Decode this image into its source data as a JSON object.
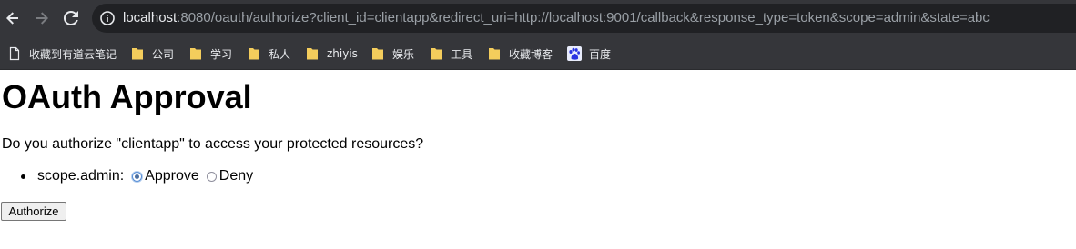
{
  "browser": {
    "url_host": "localhost",
    "url_rest": ":8080/oauth/authorize?client_id=clientapp&redirect_uri=http://localhost:9001/callback&response_type=token&scope=admin&state=abc",
    "bookmarks": [
      {
        "label": "收藏到有道云笔记",
        "icon": "page-icon"
      },
      {
        "label": "公司",
        "icon": "folder-icon"
      },
      {
        "label": "学习",
        "icon": "folder-icon"
      },
      {
        "label": "私人",
        "icon": "folder-icon"
      },
      {
        "label": "zhiyis",
        "icon": "folder-icon"
      },
      {
        "label": "娱乐",
        "icon": "folder-icon"
      },
      {
        "label": "工具",
        "icon": "folder-icon"
      },
      {
        "label": "收藏博客",
        "icon": "folder-icon"
      },
      {
        "label": "百度",
        "icon": "baidu-paw-icon"
      }
    ],
    "colors": {
      "chrome": "#35363a",
      "omnibox": "#202124",
      "folder": "#f4cd5c",
      "baidu": "#2932e1"
    }
  },
  "page": {
    "title": "OAuth Approval",
    "question": "Do you authorize \"clientapp\" to access your protected resources?",
    "scope": {
      "label": "scope.admin:",
      "approve_label": "Approve",
      "deny_label": "Deny",
      "selected": "Approve"
    },
    "authorize_label": "Authorize"
  }
}
